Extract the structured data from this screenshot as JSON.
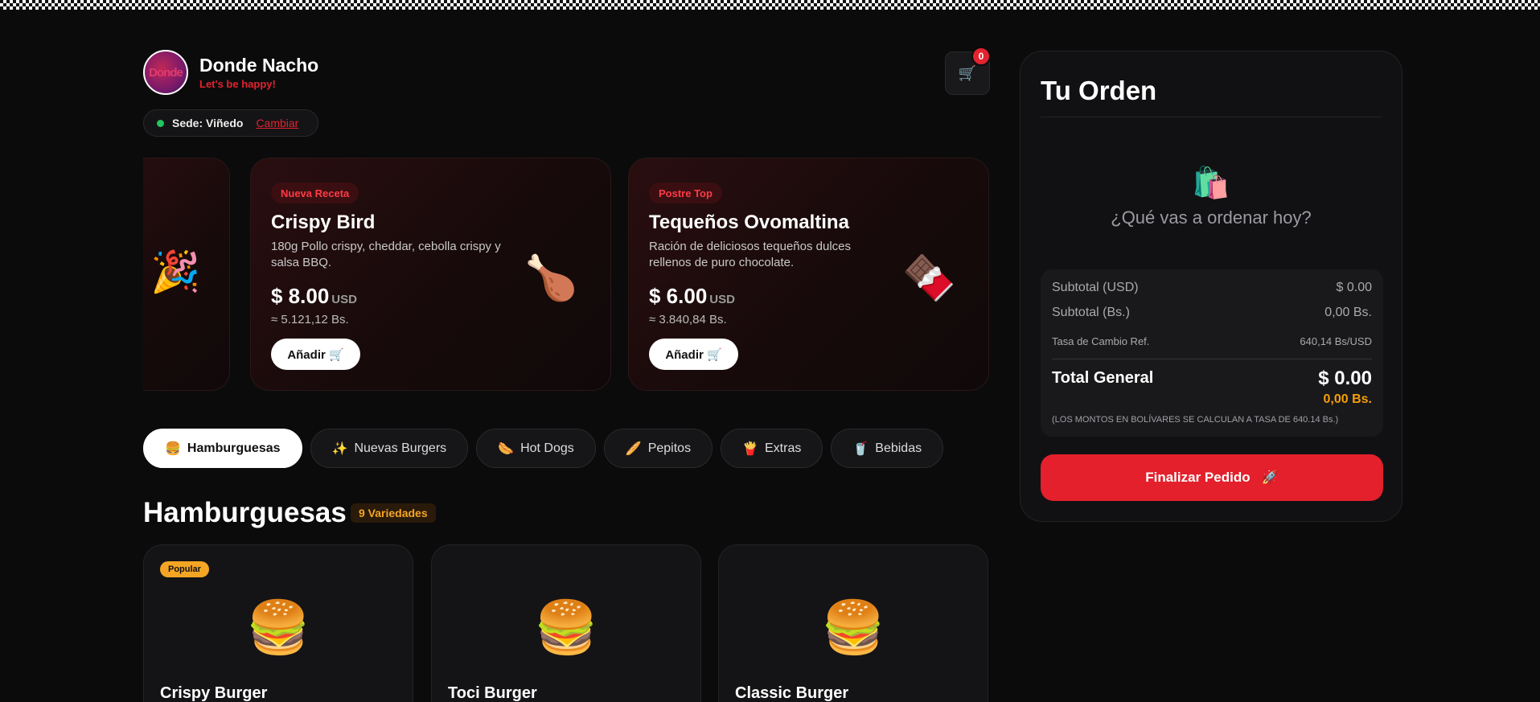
{
  "brand": {
    "name": "Donde Nacho",
    "tagline": "Let's be happy!",
    "avatar_text": "Donde"
  },
  "sede": {
    "label": "Sede: Viñedo",
    "change": "Cambiar"
  },
  "cart": {
    "icon": "🛒",
    "count": "0"
  },
  "promos": [
    {
      "emoji": "🎉"
    },
    {
      "tag": "Nueva Receta",
      "title": "Crispy Bird",
      "desc": "180g Pollo crispy, cheddar, cebolla crispy y salsa BBQ.",
      "price": "$ 8.00",
      "currency": "USD",
      "bs": "≈ 5.121,12 Bs.",
      "add": "Añadir 🛒",
      "emoji": "🍗"
    },
    {
      "tag": "Postre Top",
      "title": "Tequeños Ovomaltina",
      "desc": "Ración de deliciosos tequeños dulces rellenos de puro chocolate.",
      "price": "$ 6.00",
      "currency": "USD",
      "bs": "≈ 3.840,84 Bs.",
      "add": "Añadir 🛒",
      "emoji": "🍫"
    }
  ],
  "tabs": [
    {
      "icon": "🍔",
      "label": "Hamburguesas"
    },
    {
      "icon": "✨",
      "label": "Nuevas Burgers"
    },
    {
      "icon": "🌭",
      "label": "Hot Dogs"
    },
    {
      "icon": "🥖",
      "label": "Pepitos"
    },
    {
      "icon": "🍟",
      "label": "Extras"
    },
    {
      "icon": "🥤",
      "label": "Bebidas"
    }
  ],
  "section": {
    "title": "Hamburguesas",
    "count": "9 Variedades"
  },
  "products": [
    {
      "badge": "Popular",
      "emoji": "🍔",
      "name": "Crispy Burger"
    },
    {
      "emoji": "🍔",
      "name": "Toci Burger"
    },
    {
      "emoji": "🍔",
      "name": "Classic Burger"
    }
  ],
  "order": {
    "title": "Tu Orden",
    "empty_icon": "🛍️",
    "empty_text": "¿Qué vas a ordenar hoy?",
    "subtotal_usd_label": "Subtotal (USD)",
    "subtotal_usd": "$ 0.00",
    "subtotal_bs_label": "Subtotal (Bs.)",
    "subtotal_bs": "0,00 Bs.",
    "rate_label": "Tasa de Cambio Ref.",
    "rate": "640,14 Bs/USD",
    "total_label": "Total General",
    "total_usd": "$ 0.00",
    "total_bs": "0,00 Bs.",
    "note": "(LOS MONTOS EN BOLÍVARES SE CALCULAN A TASA DE 640.14 Bs.)",
    "finalize": "Finalizar Pedido",
    "finalize_icon": "🚀"
  }
}
